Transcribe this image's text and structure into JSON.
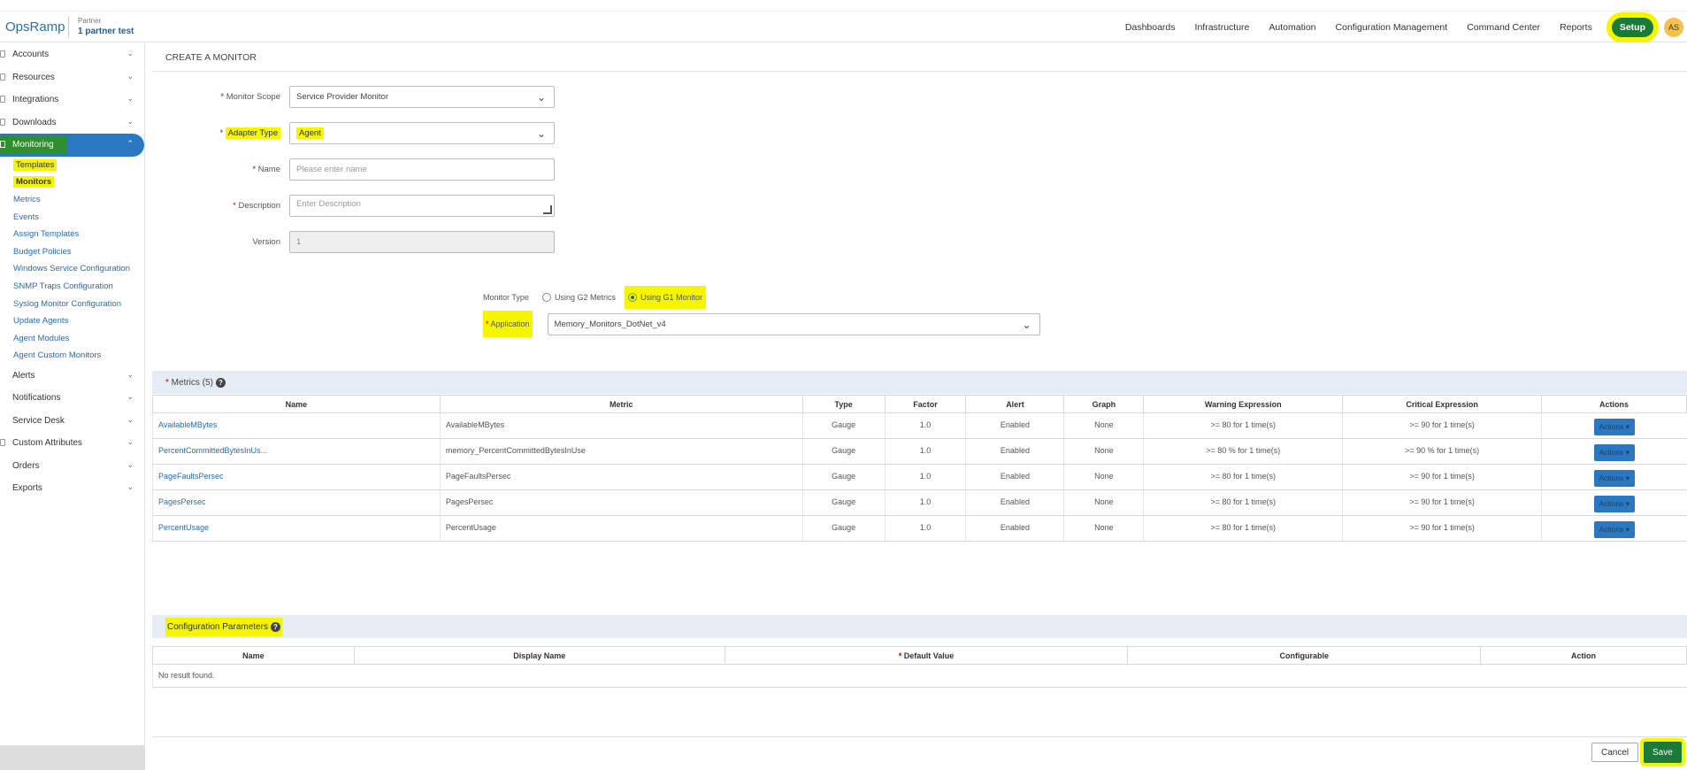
{
  "header": {
    "logo": "OpsRamp",
    "partner_label": "Partner",
    "partner_name": "1 partner test",
    "nav": [
      "Dashboards",
      "Infrastructure",
      "Automation",
      "Configuration Management",
      "Command Center",
      "Reports"
    ],
    "setup": "Setup",
    "avatar": "AS"
  },
  "sidebar": {
    "items_top": [
      {
        "label": "Accounts",
        "icon": "accounts-icon"
      },
      {
        "label": "Resources",
        "icon": "resources-icon"
      },
      {
        "label": "Integrations",
        "icon": "integrations-icon"
      },
      {
        "label": "Downloads",
        "icon": "downloads-icon"
      }
    ],
    "active": {
      "label": "Monitoring",
      "icon": "monitoring-icon"
    },
    "sub_items": [
      "Templates",
      "Monitors",
      "Metrics",
      "Events",
      "Assign Templates",
      "Budget Policies",
      "Windows Service Configuration",
      "SNMP Traps Configuration",
      "Syslog Monitor Configuration",
      "Update Agents",
      "Agent Modules",
      "Agent Custom Monitors"
    ],
    "items_bottom": [
      {
        "label": "Alerts",
        "icon": "alerts-icon"
      },
      {
        "label": "Notifications",
        "icon": "notifications-icon"
      },
      {
        "label": "Service Desk",
        "icon": "service-desk-icon"
      },
      {
        "label": "Custom Attributes",
        "icon": "custom-attributes-icon"
      },
      {
        "label": "Orders",
        "icon": "orders-icon"
      },
      {
        "label": "Exports",
        "icon": "exports-icon"
      }
    ]
  },
  "form": {
    "title": "CREATE A MONITOR",
    "monitor_scope": {
      "label": "Monitor Scope",
      "value": "Service Provider Monitor"
    },
    "adapter_type": {
      "label": "Adapter Type",
      "value": "Agent"
    },
    "name": {
      "label": "Name",
      "placeholder": "Please enter name"
    },
    "description": {
      "label": "Description",
      "placeholder": "Enter Description"
    },
    "version": {
      "label": "Version",
      "value": "1"
    },
    "monitor_type": {
      "label": "Monitor Type",
      "options": [
        "Using G2 Metrics",
        "Using G1 Monitor"
      ],
      "selected": "Using G1 Monitor"
    },
    "application": {
      "label": "Application",
      "value": "Memory_Monitors_DotNet_v4"
    }
  },
  "metrics": {
    "title": "Metrics (5)",
    "columns": [
      "Name",
      "Metric",
      "Type",
      "Factor",
      "Alert",
      "Graph",
      "Warning Expression",
      "Critical Expression",
      "Actions"
    ],
    "rows": [
      [
        "AvailableMBytes",
        "AvailableMBytes",
        "Gauge",
        "1.0",
        "Enabled",
        "None",
        ">= 80 for 1 time(s)",
        ">= 90 for 1 time(s)",
        "Actions"
      ],
      [
        "PercentCommittedBytesInUs...",
        "memory_PercentCommittedBytesInUse",
        "Gauge",
        "1.0",
        "Enabled",
        "None",
        ">= 80 % for 1 time(s)",
        ">= 90 % for 1 time(s)",
        "Actions"
      ],
      [
        "PageFaultsPersec",
        "PageFaultsPersec",
        "Gauge",
        "1.0",
        "Enabled",
        "None",
        ">= 80 for 1 time(s)",
        ">= 90 for 1 time(s)",
        "Actions"
      ],
      [
        "PagesPersec",
        "PagesPersec",
        "Gauge",
        "1.0",
        "Enabled",
        "None",
        ">= 80 for 1 time(s)",
        ">= 90 for 1 time(s)",
        "Actions"
      ],
      [
        "PercentUsage",
        "PercentUsage",
        "Gauge",
        "1.0",
        "Enabled",
        "None",
        ">= 80 for 1 time(s)",
        ">= 90 for 1 time(s)",
        "Actions"
      ]
    ]
  },
  "config_params": {
    "title": "Configuration Parameters",
    "columns": [
      "Name",
      "Display Name",
      "Default Value",
      "Configurable",
      "Action"
    ],
    "empty": "No result found."
  },
  "footer": {
    "cancel": "Cancel",
    "save": "Save"
  },
  "colors": {
    "accent": "#2b78c2",
    "setup_green": "#1a7a3a",
    "highlight": "#f5f500"
  }
}
